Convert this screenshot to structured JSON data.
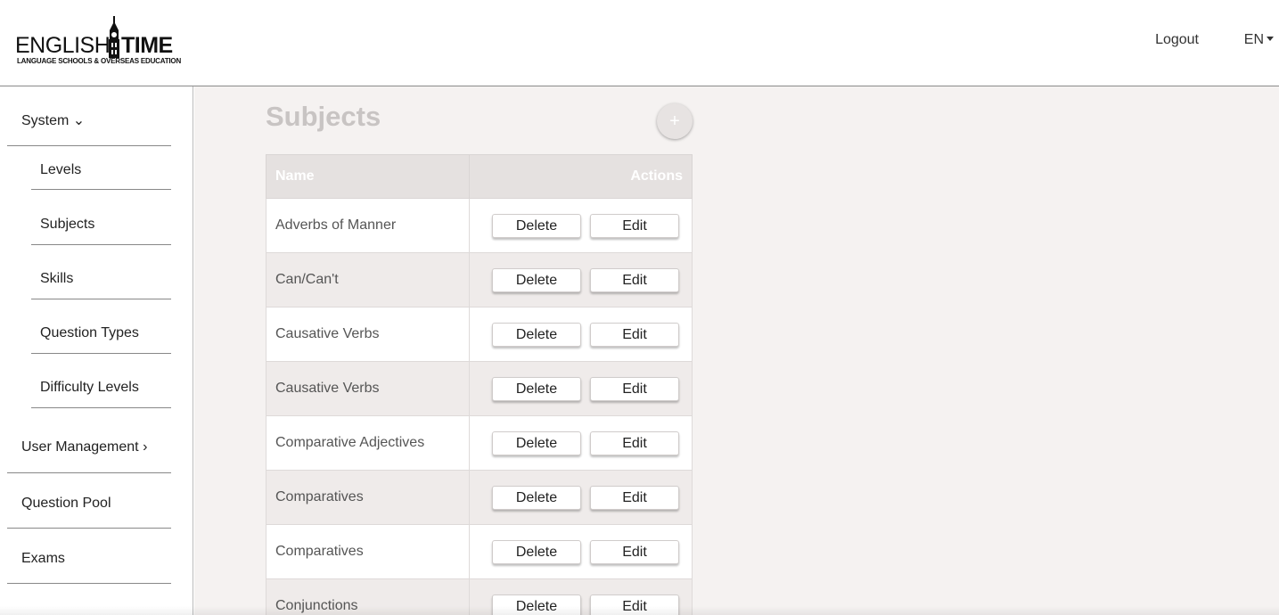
{
  "header": {
    "logo_word1": "ENGLISH",
    "logo_word2": "TIME",
    "logo_tagline": "LANGUAGE SCHOOLS & OVERSEAS EDUCATION",
    "logout_label": "Logout",
    "language": "EN"
  },
  "sidebar": {
    "system": "System ⌄",
    "levels": "Levels",
    "subjects": "Subjects",
    "skills": "Skills",
    "question_types": "Question Types",
    "difficulty_levels": "Difficulty Levels",
    "user_management": "User Management ›",
    "question_pool": "Question Pool",
    "exams": "Exams"
  },
  "main": {
    "title": "Subjects",
    "add_label": "+",
    "columns": {
      "name": "Name",
      "actions": "Actions"
    },
    "delete_label": "Delete",
    "edit_label": "Edit",
    "rows": [
      "Adverbs of Manner",
      "Can/Can't",
      "Causative Verbs",
      "Causative Verbs",
      "Comparative Adjectives",
      "Comparatives",
      "Comparatives",
      "Conjunctions"
    ]
  }
}
